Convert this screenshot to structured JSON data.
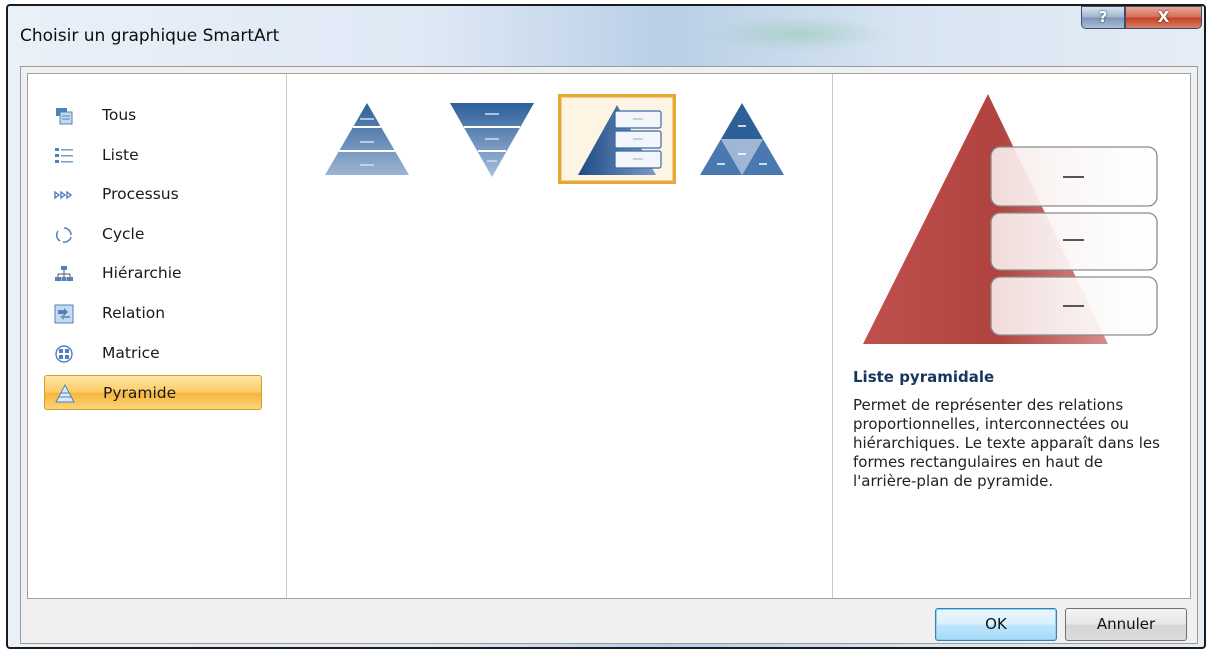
{
  "window": {
    "title": "Choisir un graphique SmartArt",
    "help_label": "?",
    "close_label": "X"
  },
  "categories": [
    {
      "label": "Tous",
      "icon": "all-layouts-icon",
      "selected": false
    },
    {
      "label": "Liste",
      "icon": "list-icon",
      "selected": false
    },
    {
      "label": "Processus",
      "icon": "process-icon",
      "selected": false
    },
    {
      "label": "Cycle",
      "icon": "cycle-icon",
      "selected": false
    },
    {
      "label": "Hiérarchie",
      "icon": "hierarchy-icon",
      "selected": false
    },
    {
      "label": "Relation",
      "icon": "relationship-icon",
      "selected": false
    },
    {
      "label": "Matrice",
      "icon": "matrix-icon",
      "selected": false
    },
    {
      "label": "Pyramide",
      "icon": "pyramid-icon",
      "selected": true
    }
  ],
  "layouts": [
    {
      "icon": "basic-pyramid-icon",
      "selected": false
    },
    {
      "icon": "inverted-pyramid-icon",
      "selected": false
    },
    {
      "icon": "pyramid-list-icon",
      "selected": true
    },
    {
      "icon": "segmented-pyramid-icon",
      "selected": false
    }
  ],
  "preview": {
    "title": "Liste pyramidale",
    "description": "Permet de représenter des relations proportionnelles, interconnectées ou hiérarchiques. Le texte apparaît dans les formes rectangulaires en haut de l'arrière-plan de pyramide."
  },
  "buttons": {
    "ok": "OK",
    "cancel": "Annuler"
  },
  "colors": {
    "pyramid_red": "#c0504d",
    "layout_blue": "#1f4e8c",
    "selection_orange": "#f7b53a"
  }
}
